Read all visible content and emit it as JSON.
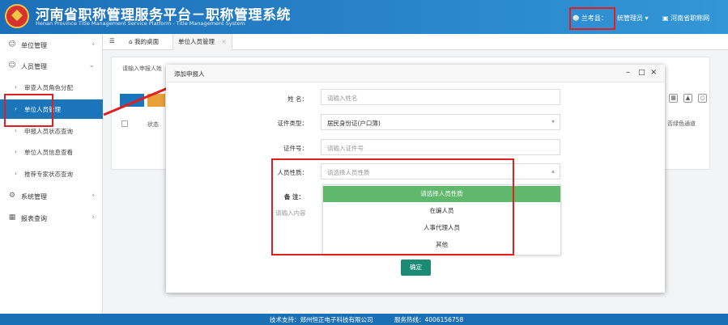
{
  "header": {
    "title_cn": "河南省职称管理服务平台－职称管理系统",
    "title_en": "Henan Province Title Management Service Platform - Title Management System",
    "user": "兰考县：",
    "role": "统管理员",
    "link": "河南省职称网"
  },
  "sidebar": {
    "menus": [
      {
        "label": "单位管理",
        "icon": "user-icon"
      },
      {
        "label": "人员管理",
        "icon": "user-icon"
      },
      {
        "label": "系统管理",
        "icon": "gear-icon"
      },
      {
        "label": "报表查询",
        "icon": "image-icon"
      }
    ],
    "sub_items": [
      {
        "label": "审查人员角色分配"
      },
      {
        "label": "单位人员管理"
      },
      {
        "label": "申报人员状态查询"
      },
      {
        "label": "单位人员信息查看"
      },
      {
        "label": "推荐专家状态查询"
      }
    ]
  },
  "tabs": {
    "home": "我的桌面",
    "active": "单位人员管理"
  },
  "background": {
    "search_placeholder": "请输入申报人姓",
    "col_status": "状态",
    "col_right": "否绿色通道"
  },
  "modal": {
    "title": "添加申报人",
    "name_label": "姓 名：",
    "name_placeholder": "请输入姓名",
    "idtype_label": "证件类型：",
    "idtype_value": "居民身份证(户口簿)",
    "idno_label": "证件号：",
    "idno_placeholder": "请输入证件号",
    "nature_label": "人员性质：",
    "nature_placeholder": "请选择人员性质",
    "remark_label": "备 注：",
    "remark_placeholder": "请输入内容",
    "confirm": "确定",
    "options": [
      "请选择人员性质",
      "在编人员",
      "人事代理人员",
      "其他"
    ]
  },
  "footer": {
    "support": "技术支持：郑州恒正电子科技有限公司",
    "hotline": "服务热线：4006156758"
  },
  "colors": {
    "header_blue": "#1c6fb8",
    "active_blue": "#1a75bb",
    "highlight_red": "#e02020",
    "select_green": "#5fb86c",
    "confirm_green": "#1b8c73"
  }
}
